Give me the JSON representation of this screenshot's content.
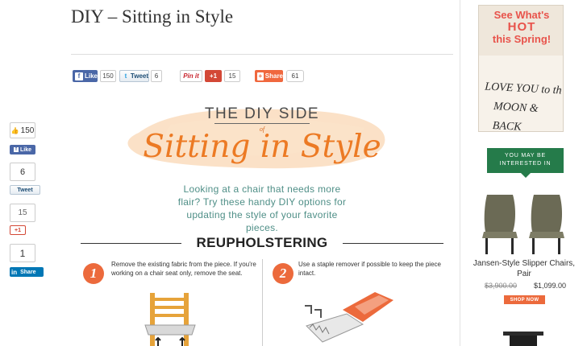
{
  "article": {
    "title": "DIY – Sitting in Style"
  },
  "share_bar": {
    "facebook_label": "Like",
    "facebook_icon": "f",
    "facebook_count": "150",
    "twitter_label": "Tweet",
    "twitter_icon": "t",
    "twitter_count": "6",
    "pinterest_label": "Pin it",
    "gplus_label": "+1",
    "gplus_count": "15",
    "share_label": "Share",
    "share_icon": "+",
    "share_count": "61"
  },
  "floating_share": {
    "like_count": "150",
    "like_icon": "👍",
    "like_label": "Like",
    "like_f": "f",
    "tweet_count": "6",
    "tweet_label": "Tweet",
    "gplus_count": "15",
    "gplus_label": "+1",
    "linkedin_count": "1",
    "linkedin_label": "Share",
    "linkedin_in": "in"
  },
  "infographic": {
    "header_top": "THE DIY SIDE",
    "header_of": "of",
    "header_main": "Sitting in Style",
    "intro": "Looking at a chair that needs more flair? Try these handy DIY options for updating the style of your favorite pieces.",
    "section_title": "REUPHOLSTERING",
    "steps": [
      {
        "number": "1",
        "text": "Remove the existing fabric from the piece. If you're working on a chair seat only, remove the seat."
      },
      {
        "number": "2",
        "text": "Use a staple remover if possible to keep the piece intact."
      }
    ]
  },
  "sidebar": {
    "ad": {
      "headline_1": "See What's",
      "headline_2": "HOT",
      "headline_3": "this Spring!",
      "pillow_line_1": "LOVE YOU to th",
      "pillow_line_2": "MOON & BACK"
    },
    "you_may_be_interested": "YOU MAY BE INTERESTED IN",
    "product": {
      "title": "Jansen-Style Slipper Chairs, Pair",
      "old_price": "$3,900.00",
      "new_price": "$1,099.00",
      "cta": "SHOP NOW"
    }
  },
  "colors": {
    "accent_orange": "#ec7a24",
    "teal_text": "#4f8f87",
    "sidebar_green": "#257b4a",
    "facebook_blue": "#4a67a7",
    "gplus_red": "#d34836",
    "linkedin_blue": "#0077b5"
  }
}
